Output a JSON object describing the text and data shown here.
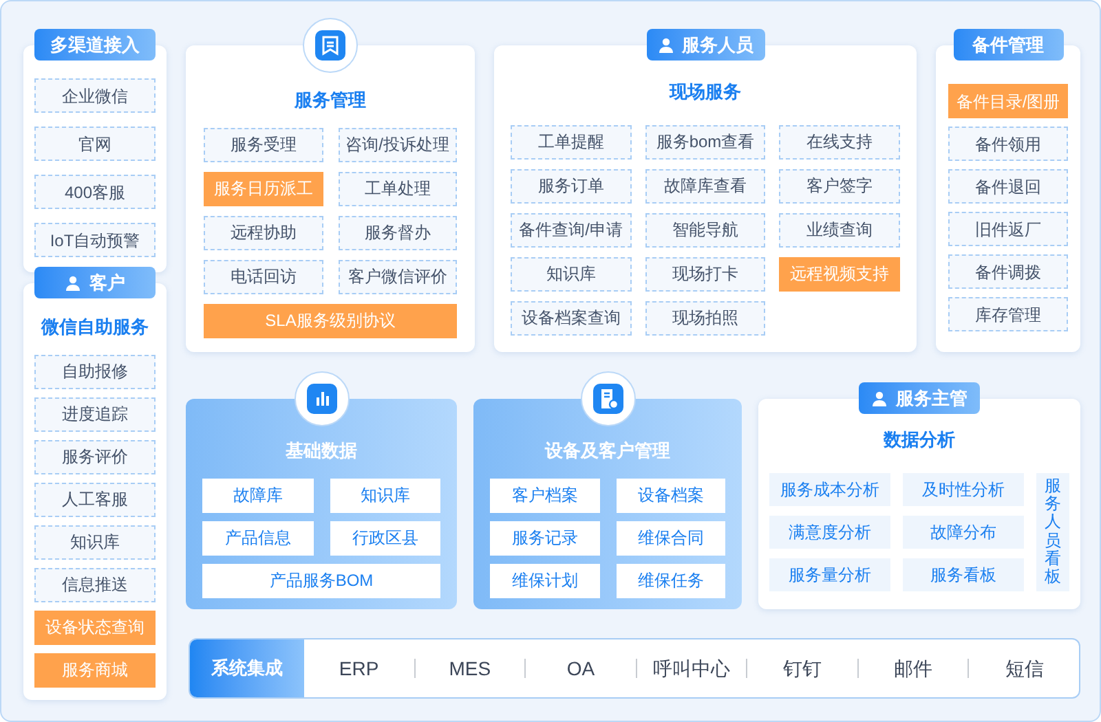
{
  "channels": {
    "tag": "多渠道接入",
    "items": [
      {
        "label": "企业微信",
        "highlighted": false
      },
      {
        "label": "官网",
        "highlighted": false
      },
      {
        "label": "400客服",
        "highlighted": false
      },
      {
        "label": "IoT自动预警",
        "highlighted": false
      }
    ]
  },
  "customer": {
    "tag": "客户",
    "title": "微信自助服务",
    "items": [
      {
        "label": "自助报修",
        "highlighted": false
      },
      {
        "label": "进度追踪",
        "highlighted": false
      },
      {
        "label": "服务评价",
        "highlighted": false
      },
      {
        "label": "人工客服",
        "highlighted": false
      },
      {
        "label": "知识库",
        "highlighted": false
      },
      {
        "label": "信息推送",
        "highlighted": false
      },
      {
        "label": "设备状态查询",
        "highlighted": true
      },
      {
        "label": "服务商城",
        "highlighted": true
      }
    ]
  },
  "service_management": {
    "title": "服务管理",
    "items": [
      {
        "label": "服务受理",
        "highlighted": false,
        "wide": false
      },
      {
        "label": "咨询/投诉处理",
        "highlighted": false,
        "wide": false
      },
      {
        "label": "服务日历派工",
        "highlighted": true,
        "wide": false
      },
      {
        "label": "工单处理",
        "highlighted": false,
        "wide": false
      },
      {
        "label": "远程协助",
        "highlighted": false,
        "wide": false
      },
      {
        "label": "服务督办",
        "highlighted": false,
        "wide": false
      },
      {
        "label": "电话回访",
        "highlighted": false,
        "wide": false
      },
      {
        "label": "客户微信评价",
        "highlighted": false,
        "wide": false
      },
      {
        "label": "SLA服务级别协议",
        "highlighted": true,
        "wide": true
      }
    ]
  },
  "field_service": {
    "tag": "服务人员",
    "title": "现场服务",
    "items": [
      {
        "label": "工单提醒",
        "highlighted": false
      },
      {
        "label": "服务bom查看",
        "highlighted": false
      },
      {
        "label": "在线支持",
        "highlighted": false
      },
      {
        "label": "服务订单",
        "highlighted": false
      },
      {
        "label": "故障库查看",
        "highlighted": false
      },
      {
        "label": "客户签字",
        "highlighted": false
      },
      {
        "label": "备件查询/申请",
        "highlighted": false
      },
      {
        "label": "智能导航",
        "highlighted": false
      },
      {
        "label": "业绩查询",
        "highlighted": false
      },
      {
        "label": "知识库",
        "highlighted": false
      },
      {
        "label": "现场打卡",
        "highlighted": false
      },
      {
        "label": "远程视频支持",
        "highlighted": true
      },
      {
        "label": "设备档案查询",
        "highlighted": false
      },
      {
        "label": "现场拍照",
        "highlighted": false
      }
    ]
  },
  "spare_parts": {
    "tag": "备件管理",
    "items": [
      {
        "label": "备件目录/图册",
        "highlighted": true
      },
      {
        "label": "备件领用",
        "highlighted": false
      },
      {
        "label": "备件退回",
        "highlighted": false
      },
      {
        "label": "旧件返厂",
        "highlighted": false
      },
      {
        "label": "备件调拨",
        "highlighted": false
      },
      {
        "label": "库存管理",
        "highlighted": false
      }
    ]
  },
  "basic_data": {
    "title": "基础数据",
    "items": [
      {
        "label": "故障库",
        "wide": false
      },
      {
        "label": "知识库",
        "wide": false
      },
      {
        "label": "产品信息",
        "wide": false
      },
      {
        "label": "行政区县",
        "wide": false
      },
      {
        "label": "产品服务BOM",
        "wide": true
      }
    ]
  },
  "device_customer": {
    "title": "设备及客户管理",
    "items": [
      {
        "label": "客户档案",
        "wide": false
      },
      {
        "label": "设备档案",
        "wide": false
      },
      {
        "label": "服务记录",
        "wide": false
      },
      {
        "label": "维保合同",
        "wide": false
      },
      {
        "label": "维保计划",
        "wide": false
      },
      {
        "label": "维保任务",
        "wide": false
      }
    ]
  },
  "analytics": {
    "tag": "服务主管",
    "title": "数据分析",
    "items": [
      "服务成本分析",
      "及时性分析",
      "满意度分析",
      "故障分布",
      "服务量分析",
      "服务看板"
    ],
    "side_item": "服务人员看板"
  },
  "integration": {
    "title": "系统集成",
    "items": [
      "ERP",
      "MES",
      "OA",
      "呼叫中心",
      "钉钉",
      "邮件",
      "短信"
    ]
  }
}
